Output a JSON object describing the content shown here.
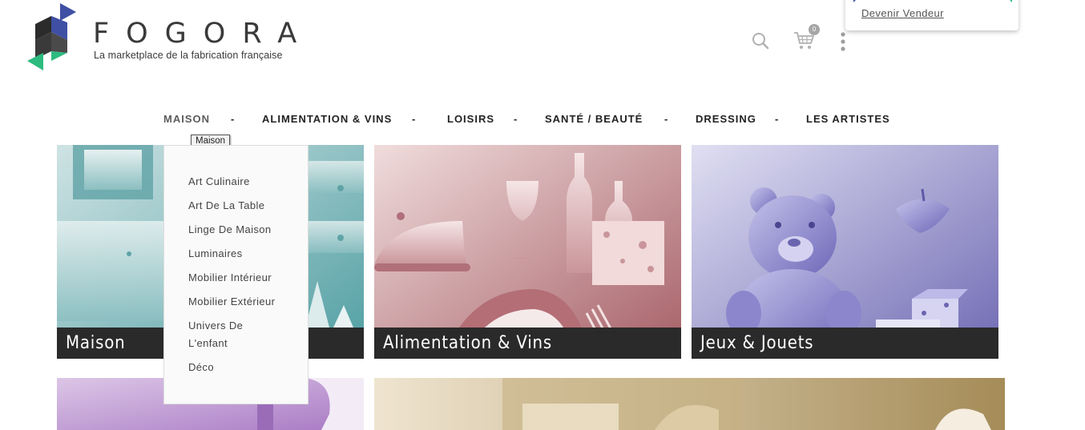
{
  "brand": {
    "name": "FOGORA",
    "tagline": "La marketplace de la fabrication française"
  },
  "header": {
    "cart_count": "0",
    "account_menu": {
      "link": "Devenir Vendeur"
    }
  },
  "nav": {
    "items": [
      {
        "label": "MAISON",
        "active": true
      },
      {
        "label": "ALIMENTATION & VINS"
      },
      {
        "label": "LOISIRS"
      },
      {
        "label": "SANTÉ / BEAUTÉ"
      },
      {
        "label": "DRESSING"
      },
      {
        "label": "LES ARTISTES"
      }
    ],
    "separator": "-",
    "tooltip": "Maison"
  },
  "submenu": {
    "items": [
      "Art Culinaire",
      "Art De La Table",
      "Linge De Maison",
      "Luminaires",
      "Mobilier Intérieur",
      "Mobilier Extérieur",
      "Univers De L'enfant",
      "Déco"
    ]
  },
  "tiles": [
    {
      "label": "Maison",
      "color": "#6fa9ab"
    },
    {
      "label": "Alimentation & Vins",
      "color": "#b97b80"
    },
    {
      "label": "Jeux & Jouets",
      "color": "#8a86c4"
    }
  ],
  "colors": {
    "logo_blue": "#3f4fa3",
    "logo_green": "#2dbb7f",
    "logo_dark": "#3a3a3a"
  }
}
